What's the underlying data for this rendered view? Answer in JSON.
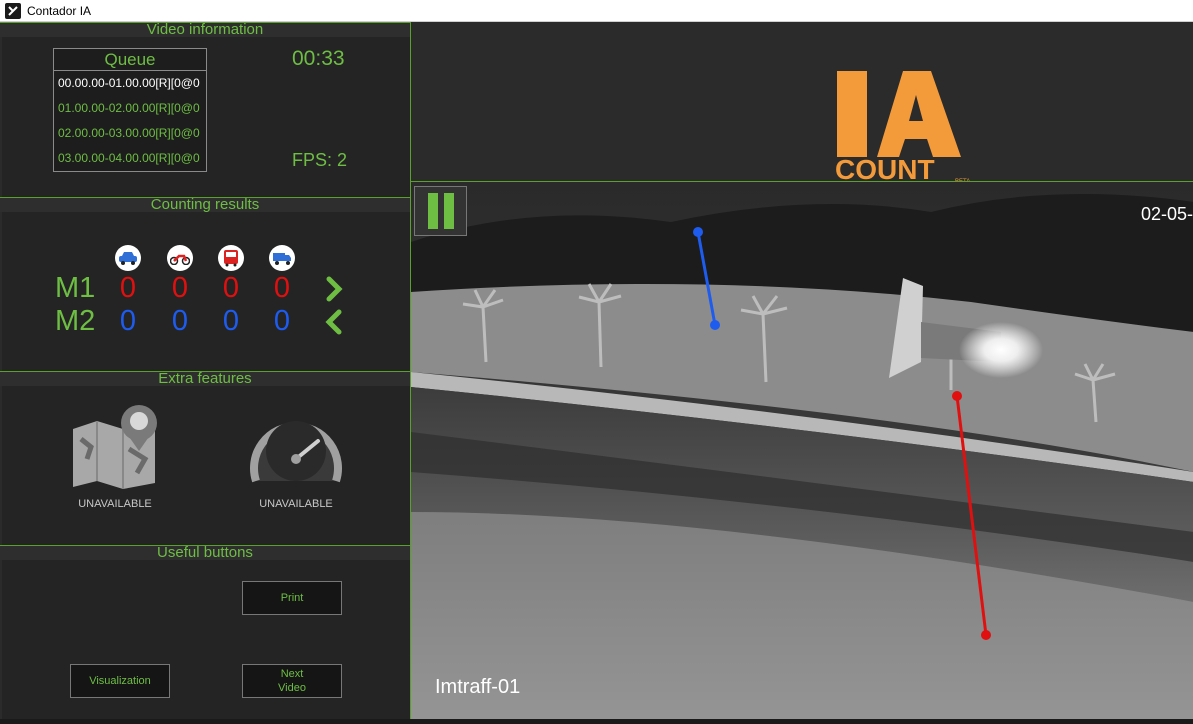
{
  "window": {
    "title": "Contador IA"
  },
  "video_info": {
    "header": "Video information",
    "queue_title": "Queue",
    "queue": [
      {
        "label": "00.00.00-01.00.00[R][0@0",
        "active": true
      },
      {
        "label": "01.00.00-02.00.00[R][0@0",
        "active": false
      },
      {
        "label": "02.00.00-03.00.00[R][0@0",
        "active": false
      },
      {
        "label": "03.00.00-04.00.00[R][0@0",
        "active": false
      }
    ],
    "timer": "00:33",
    "fps": "FPS: 2"
  },
  "counting": {
    "header": "Counting results",
    "icons": [
      "car-icon",
      "motorcycle-icon",
      "bus-icon",
      "truck-icon"
    ],
    "m1_label": "M1",
    "m2_label": "M2",
    "m1": [
      "0",
      "0",
      "0",
      "0"
    ],
    "m2": [
      "0",
      "0",
      "0",
      "0"
    ],
    "m1_color": "#e01010",
    "m2_color": "#1e5cf0"
  },
  "extra": {
    "header": "Extra features",
    "map_label": "UNAVAILABLE",
    "speed_label": "UNAVAILABLE"
  },
  "buttons": {
    "header": "Useful buttons",
    "print": "Print",
    "visualization": "Visualization",
    "next_video": "Next\nVideo"
  },
  "logo": {
    "main": "IA",
    "sub": "COUNT",
    "tag": "BETA"
  },
  "video": {
    "timestamp": "02-05-",
    "camera": "Imtraff-01",
    "line_blue_color": "#1e5cf0",
    "line_red_color": "#e01010"
  },
  "colors": {
    "accent": "#6ebe44",
    "logo": "#f39a3a"
  }
}
